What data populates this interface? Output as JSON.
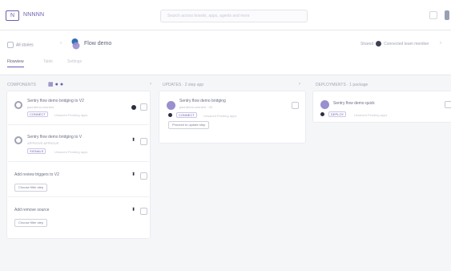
{
  "app": {
    "brand": "NNNNN",
    "logo": "N"
  },
  "search": {
    "placeholder": "Search across boards, apps, agents and more"
  },
  "nav": {
    "back_label": "All stories",
    "separator": "›",
    "flow_title": "Flow demo"
  },
  "header_right": {
    "label": "Shared",
    "user_text": "Connected team member",
    "arrow": "›"
  },
  "tabs": [
    {
      "label": "Flowview"
    },
    {
      "label": "Table"
    },
    {
      "label": "Settings"
    }
  ],
  "columns": [
    {
      "header": "COMPONENTS",
      "arrow": "›",
      "cards": [
        {
          "title": "Sentry flow demo bridging to V2",
          "subtitle": "pad.demo.connect",
          "tag": "CONNECT",
          "tag_note": "Unsaved Pending apps"
        },
        {
          "title": "Sentry flow demo bridging to V",
          "subtitle": "APPROVE APPROVE",
          "tag": "SIGNALS",
          "tag_note": "Unsaved Pending apps"
        },
        {
          "title": "Add review triggers to V2",
          "button": "Choose filter step"
        },
        {
          "title": "Add remove source",
          "button": "Choose filter step"
        }
      ]
    },
    {
      "header": "UPDATES · 2 step app",
      "arrow": "›",
      "cards": [
        {
          "title": "Sentry flow demo bridging",
          "subtitle": "pad.demo.connect · V2",
          "tag": "CONNECT",
          "tag_note": "Unsaved Pending apps",
          "button": "Proceed to update step"
        }
      ]
    },
    {
      "header": "DEPLOYMENTS · 1 package",
      "arrow": "",
      "cards": [
        {
          "title": "Sentry flow demo quick",
          "tag": "DEPLOY",
          "tag_note": "Unsaved Pending apps"
        }
      ]
    }
  ],
  "icons": [
    "grid-icon",
    "user-icon",
    "flow-icon",
    "filter-icon",
    "settings-icon",
    "add-icon"
  ],
  "colors": {
    "accent": "#6a5fae",
    "background": "#f5f6f8",
    "dark": "#2d2e40"
  }
}
